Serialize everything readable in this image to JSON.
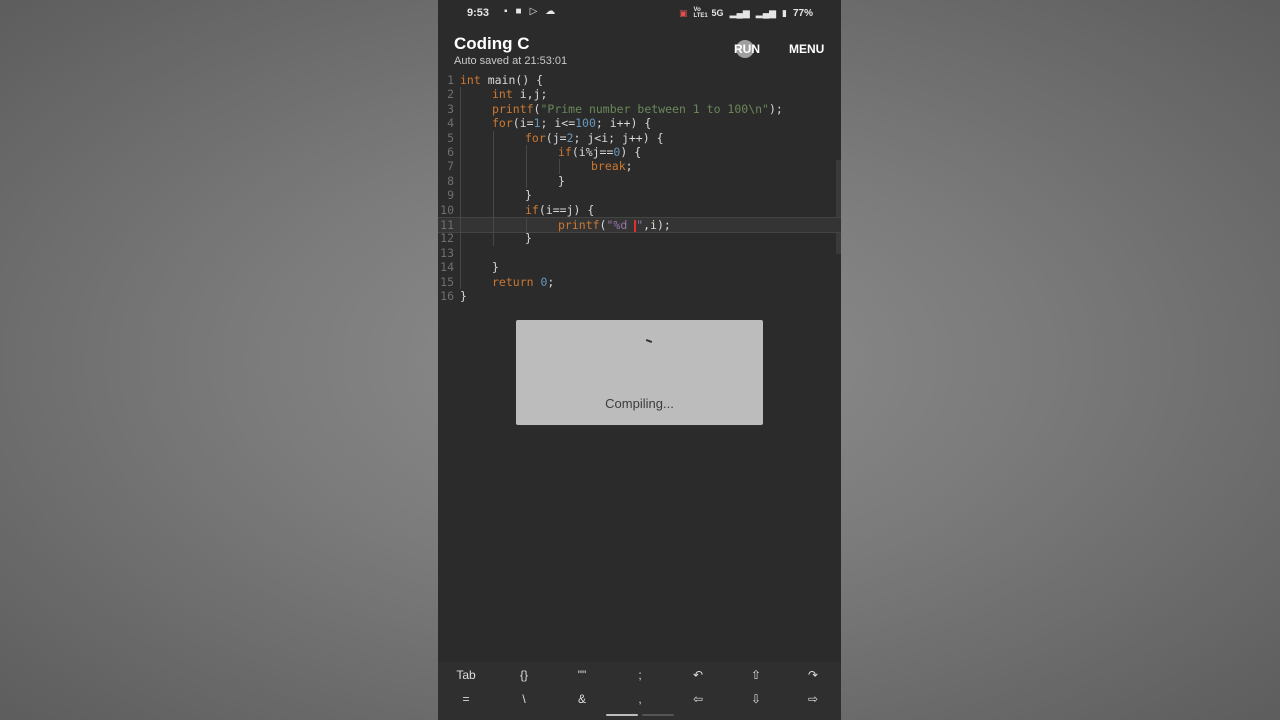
{
  "status_bar": {
    "time": "9:53",
    "left_icons": [
      "media-icon",
      "camera-icon",
      "play-store-icon",
      "cloud-icon"
    ],
    "network_labels": [
      "Vo LTE1",
      "5G"
    ],
    "battery": "77%"
  },
  "app_bar": {
    "title": "Coding C",
    "subtitle": "Auto saved at 21:53:01",
    "run_label": "RUN",
    "menu_label": "MENU"
  },
  "editor": {
    "lines": [
      {
        "n": "1",
        "indent": 0,
        "segments": [
          {
            "t": "int",
            "c": "kw"
          },
          {
            "t": " main() {",
            "c": ""
          }
        ]
      },
      {
        "n": "2",
        "indent": 1,
        "segments": [
          {
            "t": "int",
            "c": "kw"
          },
          {
            "t": " i,j;",
            "c": ""
          }
        ]
      },
      {
        "n": "3",
        "indent": 1,
        "segments": [
          {
            "t": "printf",
            "c": "kw"
          },
          {
            "t": "(",
            "c": ""
          },
          {
            "t": "\"Prime number between 1 to 100\\n\"",
            "c": "str"
          },
          {
            "t": ");",
            "c": ""
          }
        ]
      },
      {
        "n": "4",
        "indent": 1,
        "segments": [
          {
            "t": "for",
            "c": "kw"
          },
          {
            "t": "(i=",
            "c": ""
          },
          {
            "t": "1",
            "c": "num"
          },
          {
            "t": "; i<=",
            "c": ""
          },
          {
            "t": "100",
            "c": "num"
          },
          {
            "t": "; i++) {",
            "c": ""
          }
        ]
      },
      {
        "n": "5",
        "indent": 2,
        "segments": [
          {
            "t": "for",
            "c": "kw"
          },
          {
            "t": "(j=",
            "c": ""
          },
          {
            "t": "2",
            "c": "num"
          },
          {
            "t": "; j<i; j++) {",
            "c": ""
          }
        ]
      },
      {
        "n": "6",
        "indent": 3,
        "segments": [
          {
            "t": "if",
            "c": "kw"
          },
          {
            "t": "(i%j==",
            "c": ""
          },
          {
            "t": "0",
            "c": "num"
          },
          {
            "t": ") {",
            "c": ""
          }
        ]
      },
      {
        "n": "7",
        "indent": 4,
        "segments": [
          {
            "t": "break",
            "c": "kw"
          },
          {
            "t": ";",
            "c": ""
          }
        ]
      },
      {
        "n": "8",
        "indent": 3,
        "segments": [
          {
            "t": "}",
            "c": ""
          }
        ]
      },
      {
        "n": "9",
        "indent": 2,
        "segments": [
          {
            "t": "}",
            "c": ""
          }
        ]
      },
      {
        "n": "10",
        "indent": 2,
        "segments": [
          {
            "t": "if",
            "c": "kw"
          },
          {
            "t": "(i==j) {",
            "c": ""
          }
        ]
      },
      {
        "n": "11",
        "indent": 3,
        "segments": [
          {
            "t": "printf",
            "c": "kw"
          },
          {
            "t": "(",
            "c": ""
          },
          {
            "t": "\"%d ",
            "c": "fmt"
          },
          {
            "t": "",
            "c": "caret"
          },
          {
            "t": "\"",
            "c": "fmt"
          },
          {
            "t": ",i);",
            "c": ""
          }
        ],
        "highlight": true
      },
      {
        "n": "12",
        "indent": 2,
        "segments": [
          {
            "t": "}",
            "c": ""
          }
        ]
      },
      {
        "n": "13",
        "indent": 1,
        "segments": []
      },
      {
        "n": "14",
        "indent": 1,
        "segments": [
          {
            "t": "}",
            "c": ""
          }
        ]
      },
      {
        "n": "15",
        "indent": 1,
        "segments": [
          {
            "t": "return",
            "c": "kw"
          },
          {
            "t": " ",
            "c": ""
          },
          {
            "t": "0",
            "c": "num"
          },
          {
            "t": ";",
            "c": ""
          }
        ]
      },
      {
        "n": "16",
        "indent": 0,
        "segments": [
          {
            "t": "}",
            "c": ""
          }
        ]
      }
    ]
  },
  "dialog": {
    "message": "Compiling..."
  },
  "keybar": {
    "row1": [
      "Tab",
      "{}",
      "\"\"",
      ";",
      "↶",
      "⇧",
      "↷"
    ],
    "row2": [
      "=",
      "\\",
      "&",
      ",",
      "⇦",
      "⇩",
      "⇨"
    ]
  },
  "colors": {
    "background": "#2b2b2b",
    "keyword": "#cc7832",
    "string": "#6a8759",
    "number": "#6897bb",
    "caret": "#e03030"
  }
}
